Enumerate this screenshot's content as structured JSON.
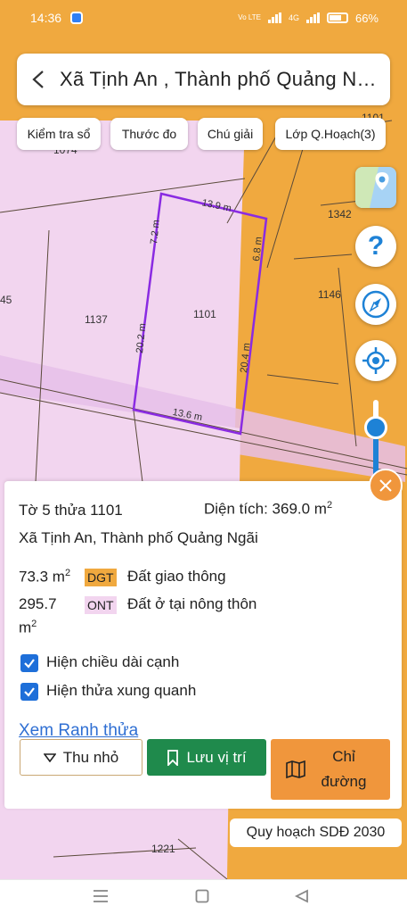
{
  "status_bar": {
    "time": "14:36",
    "network": "Vo LTE",
    "signal": "4G",
    "battery_percent": "66%"
  },
  "header": {
    "title": "Xã Tịnh An , Thành phố Quảng Ngãi"
  },
  "toolbar": {
    "check_book": "Kiểm tra sổ",
    "measure": "Thước đo",
    "legend": "Chú giải",
    "planning_layer": "Lớp Q.Hoạch(3)"
  },
  "map": {
    "parcel_labels": {
      "top": "1101",
      "north": "1074",
      "ne": "1342",
      "east": "1146",
      "west": "1137",
      "main": "1101",
      "far_west": "45",
      "south": "1221"
    },
    "edge_lengths": {
      "top": "13.9 m",
      "right_upper": "6.8 m",
      "right_lower": "20.4 m",
      "left_upper": "7.2 m",
      "left_lower": "20.2 m",
      "bottom": "13.6 m"
    },
    "colors": {
      "rural_residential": "#f2d5ef",
      "other_land": "#f0a93f",
      "traffic_land": "#e8b7ea",
      "parcel_border": "#8a2be2",
      "accent": "#1e82d6"
    }
  },
  "controls": {
    "help": "?",
    "compass": "compass-icon",
    "locate": "locate-icon"
  },
  "info": {
    "sheet_parcel": "Tờ 5 thửa 1101",
    "area_label": "Diện tích: 369.0 m",
    "area_sup": "2",
    "location": "Xã Tịnh An, Thành phố Quảng Ngãi",
    "land_uses": [
      {
        "area": "73.3 m",
        "sup": "2",
        "code": "DGT",
        "code_color": "#f0a93f",
        "name": "Đất giao thông"
      },
      {
        "area": "295.7",
        "area_line2": "m",
        "sup": "2",
        "code": "ONT",
        "code_color": "#f2d5ef",
        "name": "Đất ở tại nông thôn"
      }
    ],
    "show_edge_lengths": "Hiện chiều dài cạnh",
    "show_neighbors": "Hiện thửa xung quanh",
    "view_boundary": "Xem Ranh thửa"
  },
  "actions": {
    "collapse": "Thu nhỏ",
    "save_location": "Lưu vị trí",
    "directions_line1": "Chỉ",
    "directions_line2": "đường"
  },
  "planning_label": "Quy hoạch SDĐ 2030"
}
